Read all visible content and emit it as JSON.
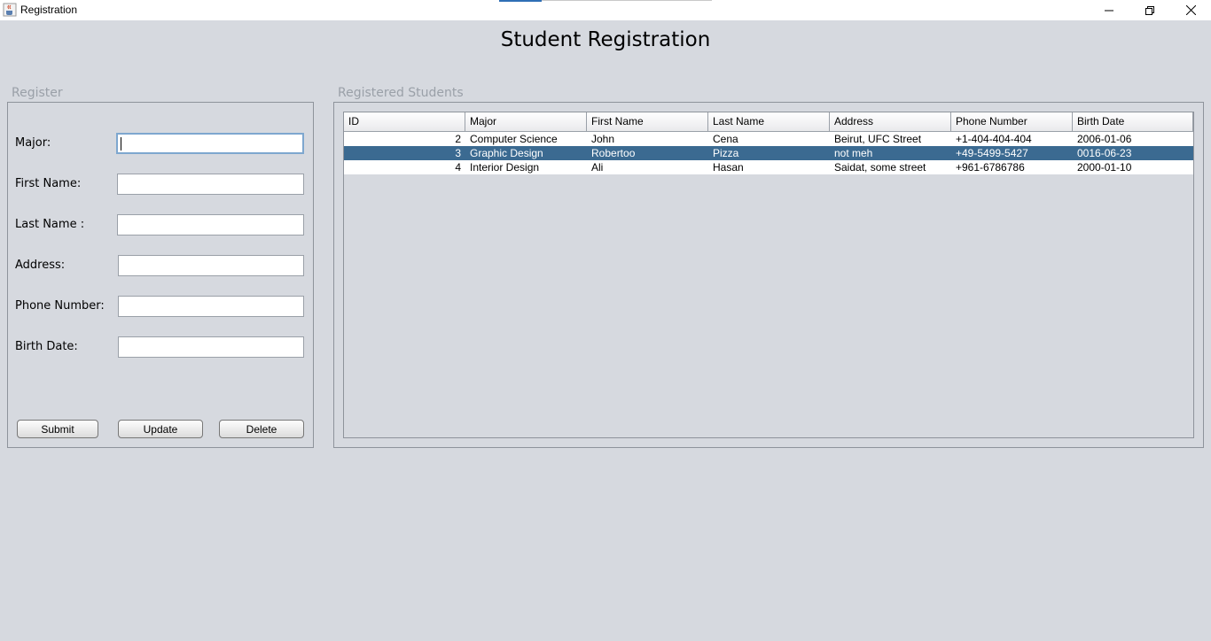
{
  "window": {
    "title": "Registration",
    "app_icon": "java-cup-icon",
    "controls": [
      "minimize-icon",
      "restore-icon",
      "close-icon"
    ]
  },
  "page": {
    "title": "Student Registration"
  },
  "register_panel": {
    "title": "Register",
    "fields": [
      {
        "label": "Major:",
        "value": ""
      },
      {
        "label": "First Name:",
        "value": ""
      },
      {
        "label": "Last Name :",
        "value": ""
      },
      {
        "label": "Address:",
        "value": ""
      },
      {
        "label": "Phone Number:",
        "value": ""
      },
      {
        "label": "Birth Date:",
        "value": ""
      }
    ],
    "buttons": {
      "submit": "Submit",
      "update": "Update",
      "delete": "Delete"
    }
  },
  "students_panel": {
    "title": "Registered Students",
    "columns": [
      "ID",
      "Major",
      "First Name",
      "Last Name",
      "Address",
      "Phone Number",
      "Birth Date"
    ],
    "rows": [
      [
        "2",
        "Computer Science",
        "John",
        "Cena",
        "Beirut, UFC Street",
        "+1-404-404-404",
        "2006-01-06"
      ],
      [
        "3",
        "Graphic Design",
        "Robertoo",
        "Pizza",
        "not meh",
        "+49-5499-5427",
        "0016-06-23"
      ],
      [
        "4",
        "Interior Design",
        "Ali",
        "Hasan",
        "Saidat, some street",
        "+961-6786786",
        "2000-01-10"
      ]
    ],
    "selected_row": 1
  },
  "colors": {
    "background": "#d6d9df",
    "selection": "#3b6a91",
    "group_title": "#9aa0a8"
  }
}
